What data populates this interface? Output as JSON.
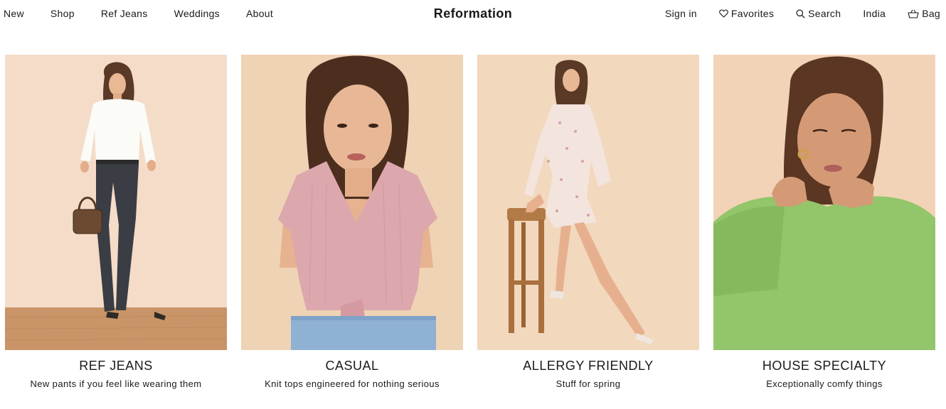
{
  "header": {
    "brand": "Reformation",
    "nav_left": [
      {
        "label": "New"
      },
      {
        "label": "Shop"
      },
      {
        "label": "Ref Jeans"
      },
      {
        "label": "Weddings"
      },
      {
        "label": "About"
      }
    ],
    "nav_right": {
      "sign_in": "Sign in",
      "favorites": "Favorites",
      "search": "Search",
      "country": "India",
      "bag": "Bag"
    },
    "icons": {
      "favorites": "heart-icon",
      "search": "search-icon",
      "bag": "bag-icon"
    }
  },
  "cards": [
    {
      "title": "REF JEANS",
      "subtitle": "New pants if you feel like wearing them"
    },
    {
      "title": "CASUAL",
      "subtitle": "Knit tops engineered for nothing serious"
    },
    {
      "title": "ALLERGY FRIENDLY",
      "subtitle": "Stuff for spring"
    },
    {
      "title": "HOUSE SPECIALTY",
      "subtitle": "Exceptionally comfy things"
    }
  ],
  "colors": {
    "text": "#1a1a1a",
    "background": "#ffffff",
    "card1_bg": "#f4d9c3",
    "card2_bg": "#efd3b4",
    "card3_bg": "#f1d6b9",
    "card4_bg": "#f3d2b7",
    "sweater_green": "#93c56a",
    "top_pink": "#dca7ad"
  }
}
